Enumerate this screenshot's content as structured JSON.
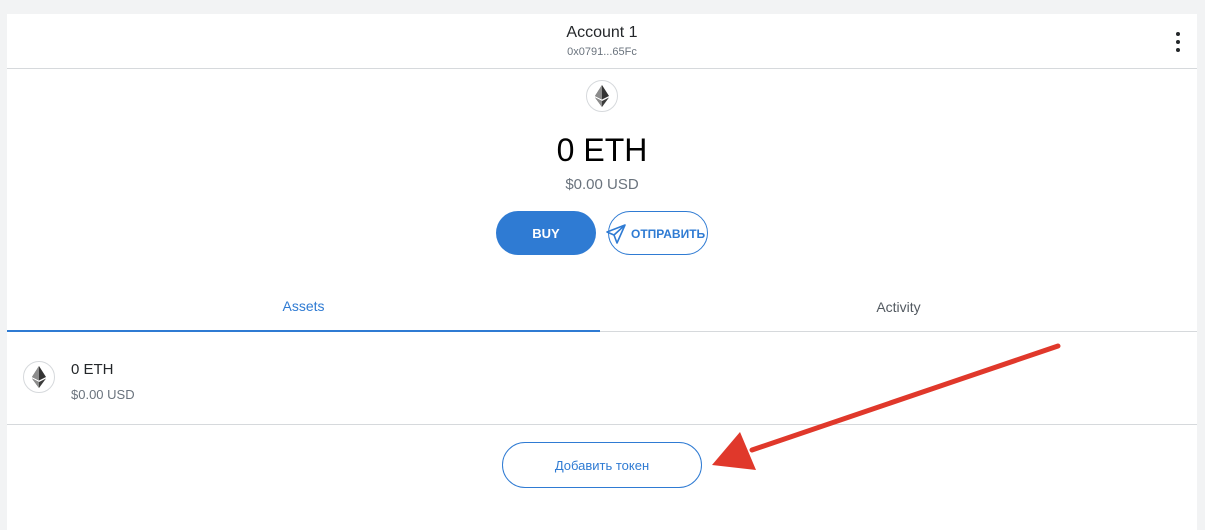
{
  "header": {
    "account_name": "Account 1",
    "account_address": "0x0791...65Fc"
  },
  "balance": {
    "primary": "0 ETH",
    "secondary": "$0.00 USD"
  },
  "actions": {
    "buy_label": "BUY",
    "send_label": "ОТПРАВИТЬ"
  },
  "tabs": [
    {
      "label": "Assets",
      "active": true
    },
    {
      "label": "Activity",
      "active": false
    }
  ],
  "assets": [
    {
      "primary": "0 ETH",
      "secondary": "$0.00 USD",
      "icon": "eth-icon"
    }
  ],
  "add_token_label": "Добавить токен",
  "colors": {
    "accent": "#2f7bd3",
    "annotation_arrow": "#e0382b"
  }
}
